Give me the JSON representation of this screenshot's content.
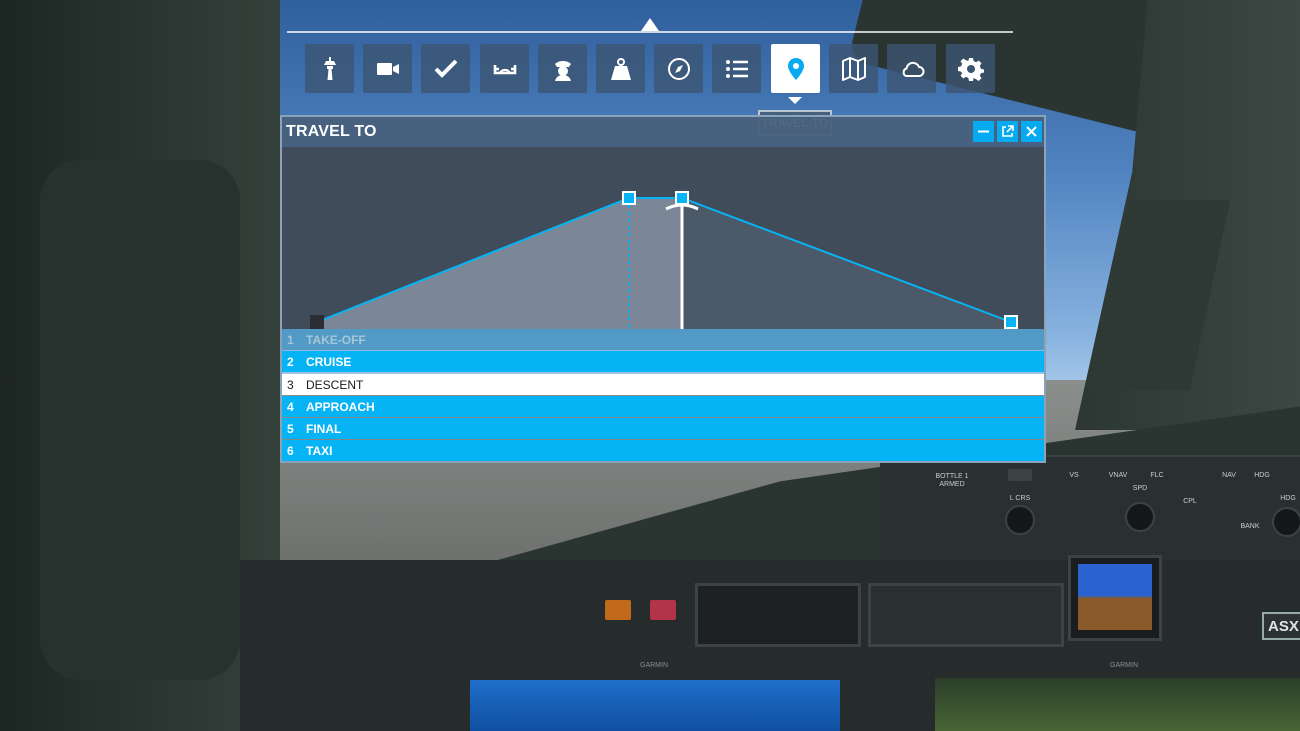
{
  "toolbar": {
    "buttons": [
      {
        "name": "tower-icon",
        "tooltip": ""
      },
      {
        "name": "camera-icon",
        "tooltip": ""
      },
      {
        "name": "checklist-icon",
        "tooltip": ""
      },
      {
        "name": "yoke-icon",
        "tooltip": ""
      },
      {
        "name": "pilot-icon",
        "tooltip": ""
      },
      {
        "name": "weight-icon",
        "tooltip": ""
      },
      {
        "name": "compass-icon",
        "tooltip": ""
      },
      {
        "name": "list-icon",
        "tooltip": ""
      },
      {
        "name": "location-pin-icon",
        "tooltip": "TRAVEL TO",
        "active": true
      },
      {
        "name": "map-icon",
        "tooltip": ""
      },
      {
        "name": "cloud-icon",
        "tooltip": ""
      },
      {
        "name": "gear-icon",
        "tooltip": ""
      }
    ],
    "tooltip": "TRAVEL TO"
  },
  "travel_to": {
    "title": "TRAVEL TO",
    "controls": [
      "minimize-icon",
      "popout-icon",
      "close-icon"
    ],
    "phases": [
      {
        "num": "1",
        "label": "TAKE-OFF",
        "state": "done"
      },
      {
        "num": "2",
        "label": "CRUISE",
        "state": "upcoming"
      },
      {
        "num": "3",
        "label": "DESCENT",
        "state": "current"
      },
      {
        "num": "4",
        "label": "APPROACH",
        "state": "upcoming"
      },
      {
        "num": "5",
        "label": "FINAL",
        "state": "upcoming"
      },
      {
        "num": "6",
        "label": "TAXI",
        "state": "upcoming"
      }
    ]
  },
  "cockpit": {
    "bottle_label": "BOTTLE 1\nARMED",
    "l_crs": "L CRS",
    "spd": "SPD",
    "hdg": "HDG",
    "bank": "BANK",
    "cpl": "CPL",
    "asx": "ASX",
    "garmin": "GARMIN",
    "ap_buttons": [
      "VS",
      "VNAV",
      "FLC",
      "NAV",
      "HDG"
    ]
  },
  "colors": {
    "accent": "#06b4f5",
    "header": "#48607c",
    "toolbar_button": "#3c5573"
  }
}
